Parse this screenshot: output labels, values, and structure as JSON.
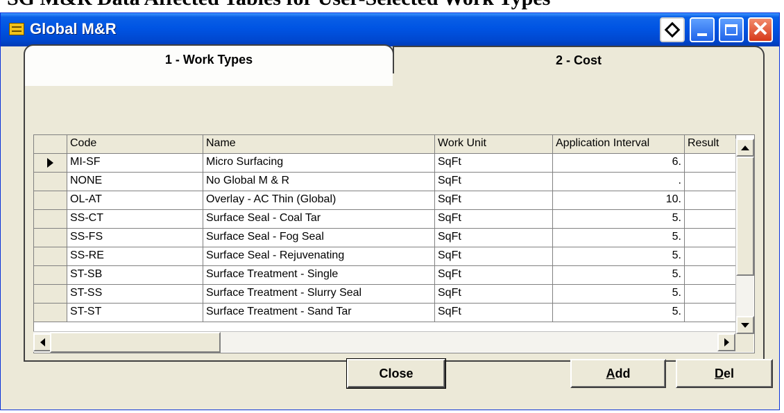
{
  "doc_heading": "SG M&R Data Affected Tables for User-Selected Work Types",
  "window": {
    "title": "Global M&R"
  },
  "tabs": [
    {
      "label": "1 - Work Types",
      "active": true
    },
    {
      "label": "2 - Cost",
      "active": false
    }
  ],
  "grid": {
    "columns": [
      "Code",
      "Name",
      "Work Unit",
      "Application Interval",
      "Result"
    ],
    "rows": [
      {
        "code": "MI-SF",
        "name": "Micro Surfacing",
        "unit": "SqFt",
        "interval": "6.",
        "result": "",
        "current": true
      },
      {
        "code": "NONE",
        "name": "No Global M & R",
        "unit": "SqFt",
        "interval": ".",
        "result": "",
        "current": false
      },
      {
        "code": "OL-AT",
        "name": "Overlay - AC Thin (Global)",
        "unit": "SqFt",
        "interval": "10.",
        "result": "",
        "current": false
      },
      {
        "code": "SS-CT",
        "name": "Surface Seal - Coal Tar",
        "unit": "SqFt",
        "interval": "5.",
        "result": "",
        "current": false
      },
      {
        "code": "SS-FS",
        "name": "Surface Seal - Fog Seal",
        "unit": "SqFt",
        "interval": "5.",
        "result": "",
        "current": false
      },
      {
        "code": "SS-RE",
        "name": "Surface Seal - Rejuvenating",
        "unit": "SqFt",
        "interval": "5.",
        "result": "",
        "current": false
      },
      {
        "code": "ST-SB",
        "name": "Surface Treatment - Single",
        "unit": "SqFt",
        "interval": "5.",
        "result": "",
        "current": false
      },
      {
        "code": "ST-SS",
        "name": "Surface Treatment - Slurry Seal",
        "unit": "SqFt",
        "interval": "5.",
        "result": "",
        "current": false
      },
      {
        "code": "ST-ST",
        "name": "Surface Treatment - Sand Tar",
        "unit": "SqFt",
        "interval": "5.",
        "result": "",
        "current": false
      }
    ]
  },
  "buttons": {
    "close": "Close",
    "add_pre": "",
    "add_mn": "A",
    "add_post": "dd",
    "del_pre": "",
    "del_mn": "D",
    "del_post": "el"
  },
  "icons": {
    "app": "app-window-icon",
    "help": "diamond-icon",
    "minimize": "minimize-icon",
    "maximize": "maximize-icon",
    "close": "close-icon"
  },
  "colors": {
    "titlebar": "#0054e3",
    "dialog_bg": "#ece9d8",
    "close_btn": "#d6391a"
  }
}
